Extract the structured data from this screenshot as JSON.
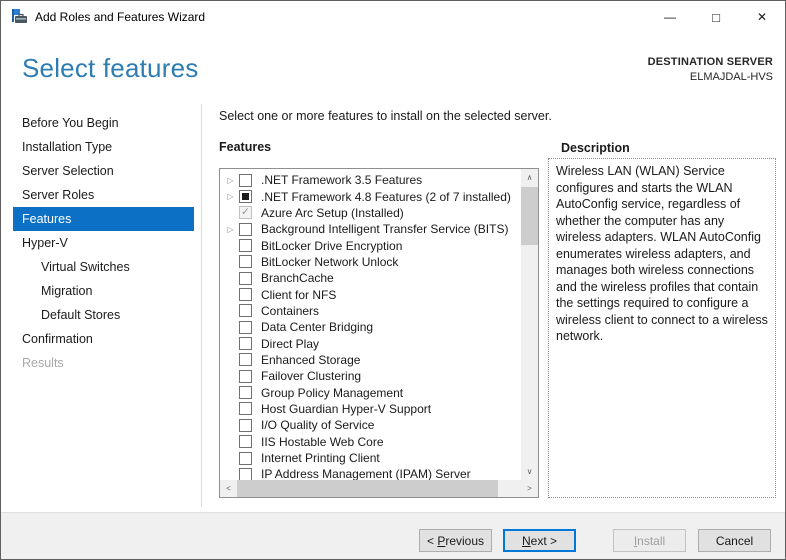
{
  "window": {
    "title": "Add Roles and Features Wizard"
  },
  "icons": {
    "minimize": "—",
    "maximize": "□",
    "close": "✕",
    "expander": "▷",
    "check": "✓",
    "scroll_up": "∧",
    "scroll_down": "∨",
    "scroll_left": "<",
    "scroll_right": ">"
  },
  "colors": {
    "heading_blue": "#2d7db3",
    "nav_selected_bg": "#0c71c4",
    "default_button_border": "#0078d7",
    "disabled_text": "#a9a9a9",
    "footer_bg": "#f0f0f0"
  },
  "header": {
    "title": "Select features",
    "destination_label": "DESTINATION SERVER",
    "destination_server": "ELMAJDAL-HVS"
  },
  "sidebar": {
    "items": [
      {
        "label": "Before You Begin",
        "indent": 0,
        "state": "normal"
      },
      {
        "label": "Installation Type",
        "indent": 0,
        "state": "normal"
      },
      {
        "label": "Server Selection",
        "indent": 0,
        "state": "normal"
      },
      {
        "label": "Server Roles",
        "indent": 0,
        "state": "normal"
      },
      {
        "label": "Features",
        "indent": 0,
        "state": "selected"
      },
      {
        "label": "Hyper-V",
        "indent": 0,
        "state": "normal"
      },
      {
        "label": "Virtual Switches",
        "indent": 1,
        "state": "normal"
      },
      {
        "label": "Migration",
        "indent": 1,
        "state": "normal"
      },
      {
        "label": "Default Stores",
        "indent": 1,
        "state": "normal"
      },
      {
        "label": "Confirmation",
        "indent": 0,
        "state": "normal"
      },
      {
        "label": "Results",
        "indent": 0,
        "state": "disabled"
      }
    ]
  },
  "main": {
    "instruction": "Select one or more features to install on the selected server.",
    "features_label": "Features",
    "features": [
      {
        "label": ".NET Framework 3.5 Features",
        "expander": true,
        "checkbox": "unchecked"
      },
      {
        "label": ".NET Framework 4.8 Features (2 of 7 installed)",
        "expander": true,
        "checkbox": "indeterminate"
      },
      {
        "label": "Azure Arc Setup (Installed)",
        "expander": false,
        "checkbox": "checked-disabled"
      },
      {
        "label": "Background Intelligent Transfer Service (BITS)",
        "expander": true,
        "checkbox": "unchecked"
      },
      {
        "label": "BitLocker Drive Encryption",
        "expander": false,
        "checkbox": "unchecked"
      },
      {
        "label": "BitLocker Network Unlock",
        "expander": false,
        "checkbox": "unchecked"
      },
      {
        "label": "BranchCache",
        "expander": false,
        "checkbox": "unchecked"
      },
      {
        "label": "Client for NFS",
        "expander": false,
        "checkbox": "unchecked"
      },
      {
        "label": "Containers",
        "expander": false,
        "checkbox": "unchecked"
      },
      {
        "label": "Data Center Bridging",
        "expander": false,
        "checkbox": "unchecked"
      },
      {
        "label": "Direct Play",
        "expander": false,
        "checkbox": "unchecked"
      },
      {
        "label": "Enhanced Storage",
        "expander": false,
        "checkbox": "unchecked"
      },
      {
        "label": "Failover Clustering",
        "expander": false,
        "checkbox": "unchecked"
      },
      {
        "label": "Group Policy Management",
        "expander": false,
        "checkbox": "unchecked"
      },
      {
        "label": "Host Guardian Hyper-V Support",
        "expander": false,
        "checkbox": "unchecked"
      },
      {
        "label": "I/O Quality of Service",
        "expander": false,
        "checkbox": "unchecked"
      },
      {
        "label": "IIS Hostable Web Core",
        "expander": false,
        "checkbox": "unchecked"
      },
      {
        "label": "Internet Printing Client",
        "expander": false,
        "checkbox": "unchecked"
      },
      {
        "label": "IP Address Management (IPAM) Server",
        "expander": false,
        "checkbox": "unchecked"
      }
    ]
  },
  "description": {
    "label": "Description",
    "text": "Wireless LAN (WLAN) Service configures and starts the WLAN AutoConfig service, regardless of whether the computer has any wireless adapters. WLAN AutoConfig enumerates wireless adapters, and manages both wireless connections and the wireless profiles that contain the settings required to configure a wireless client to connect to a wireless network."
  },
  "footer": {
    "buttons": [
      {
        "pre": "< ",
        "key": "P",
        "post": "revious",
        "state": "normal"
      },
      {
        "pre": "",
        "key": "N",
        "post": "ext >",
        "state": "default"
      },
      {
        "pre": "",
        "key": "I",
        "post": "nstall",
        "state": "disabled"
      },
      {
        "pre": "",
        "key": "",
        "post": "Cancel",
        "state": "normal"
      }
    ]
  }
}
